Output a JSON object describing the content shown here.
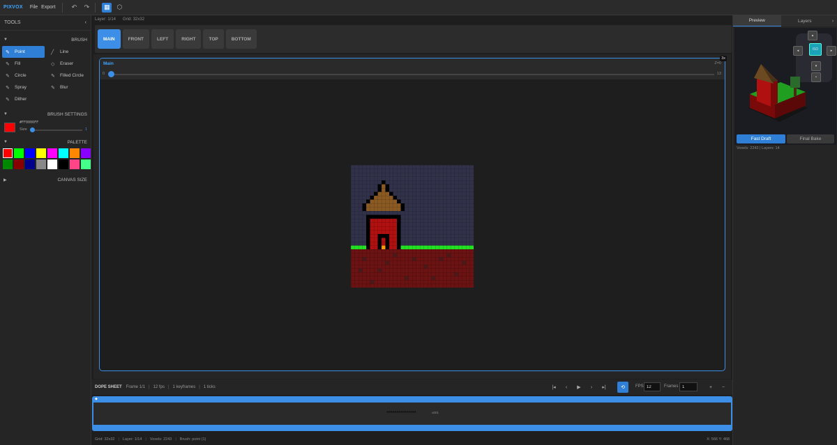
{
  "app": {
    "logo": "PIXVOX",
    "menu": [
      "File",
      "Export"
    ]
  },
  "toolbar": {
    "undo": "undo-icon",
    "redo": "redo-icon",
    "grid_toggle": "grid-icon",
    "cube_toggle": "cube-icon"
  },
  "left": {
    "tools_title": "TOOLS",
    "brush_title": "BRUSH",
    "brushes": [
      {
        "label": "Point",
        "icon": "pencil-icon",
        "active": true
      },
      {
        "label": "Line",
        "icon": "line-icon",
        "active": false
      },
      {
        "label": "Fill",
        "icon": "fill-icon",
        "active": false
      },
      {
        "label": "Eraser",
        "icon": "eraser-icon",
        "active": false
      },
      {
        "label": "Circle",
        "icon": "circle-icon",
        "active": false
      },
      {
        "label": "Filled Circle",
        "icon": "filled-circle-icon",
        "active": false
      },
      {
        "label": "Spray",
        "icon": "spray-icon",
        "active": false
      },
      {
        "label": "Blur",
        "icon": "blur-icon",
        "active": false
      },
      {
        "label": "Dither",
        "icon": "dither-icon",
        "active": false
      }
    ],
    "brush_settings_title": "BRUSH SETTINGS",
    "color_hex": "#FF0000FF",
    "size_label": "Size",
    "size_value": "1",
    "palette_title": "PALETTE",
    "palette": [
      "#ff0000",
      "#00ff00",
      "#0000ff",
      "#ffff00",
      "#ff00ff",
      "#00ffff",
      "#ff8800",
      "#8800ff",
      "#008800",
      "#880000",
      "#000088",
      "#888888",
      "#ffffff",
      "#000000",
      "#ff4488",
      "#44ff88"
    ],
    "canvas_size_title": "CANVAS SIZE"
  },
  "layer_bar": {
    "layer": "Layer: 1/14",
    "grid": "Grid: 32x32"
  },
  "view_tabs": [
    "MAIN",
    "FRONT",
    "LEFT",
    "RIGHT",
    "TOP",
    "BOTTOM"
  ],
  "viewport": {
    "title": "Main",
    "zoom": "3x",
    "range_right": "Z=0",
    "slider_min": "0",
    "slider_max": "13"
  },
  "dope": {
    "title": "DOPE SHEET",
    "frame": "Frame 1/1",
    "fps_info": "12 fps",
    "keyframes": "1 keyframes",
    "ticks": "1 ticks",
    "fps_label": "FPS",
    "fps_value": "12",
    "frames_label": "Frames",
    "frames_value": "1"
  },
  "timeline": {
    "track_label": "●●●●●●●●●●●●●●●",
    "track_tail": "u001"
  },
  "status": {
    "grid": "Grid: 32x32",
    "layer": "Layer: 1/14",
    "voxels": "Voxels: 2243",
    "brush": "Brush: point (1)",
    "coords": "X: 566  Y: 468"
  },
  "right": {
    "tab_preview": "Preview",
    "tab_layers": "Layers",
    "iso_label": "ISO",
    "fast_draft": "Fast Draft",
    "final_bake": "Final Bake",
    "stats": "Voxels: 2243 | Layers: 14"
  }
}
